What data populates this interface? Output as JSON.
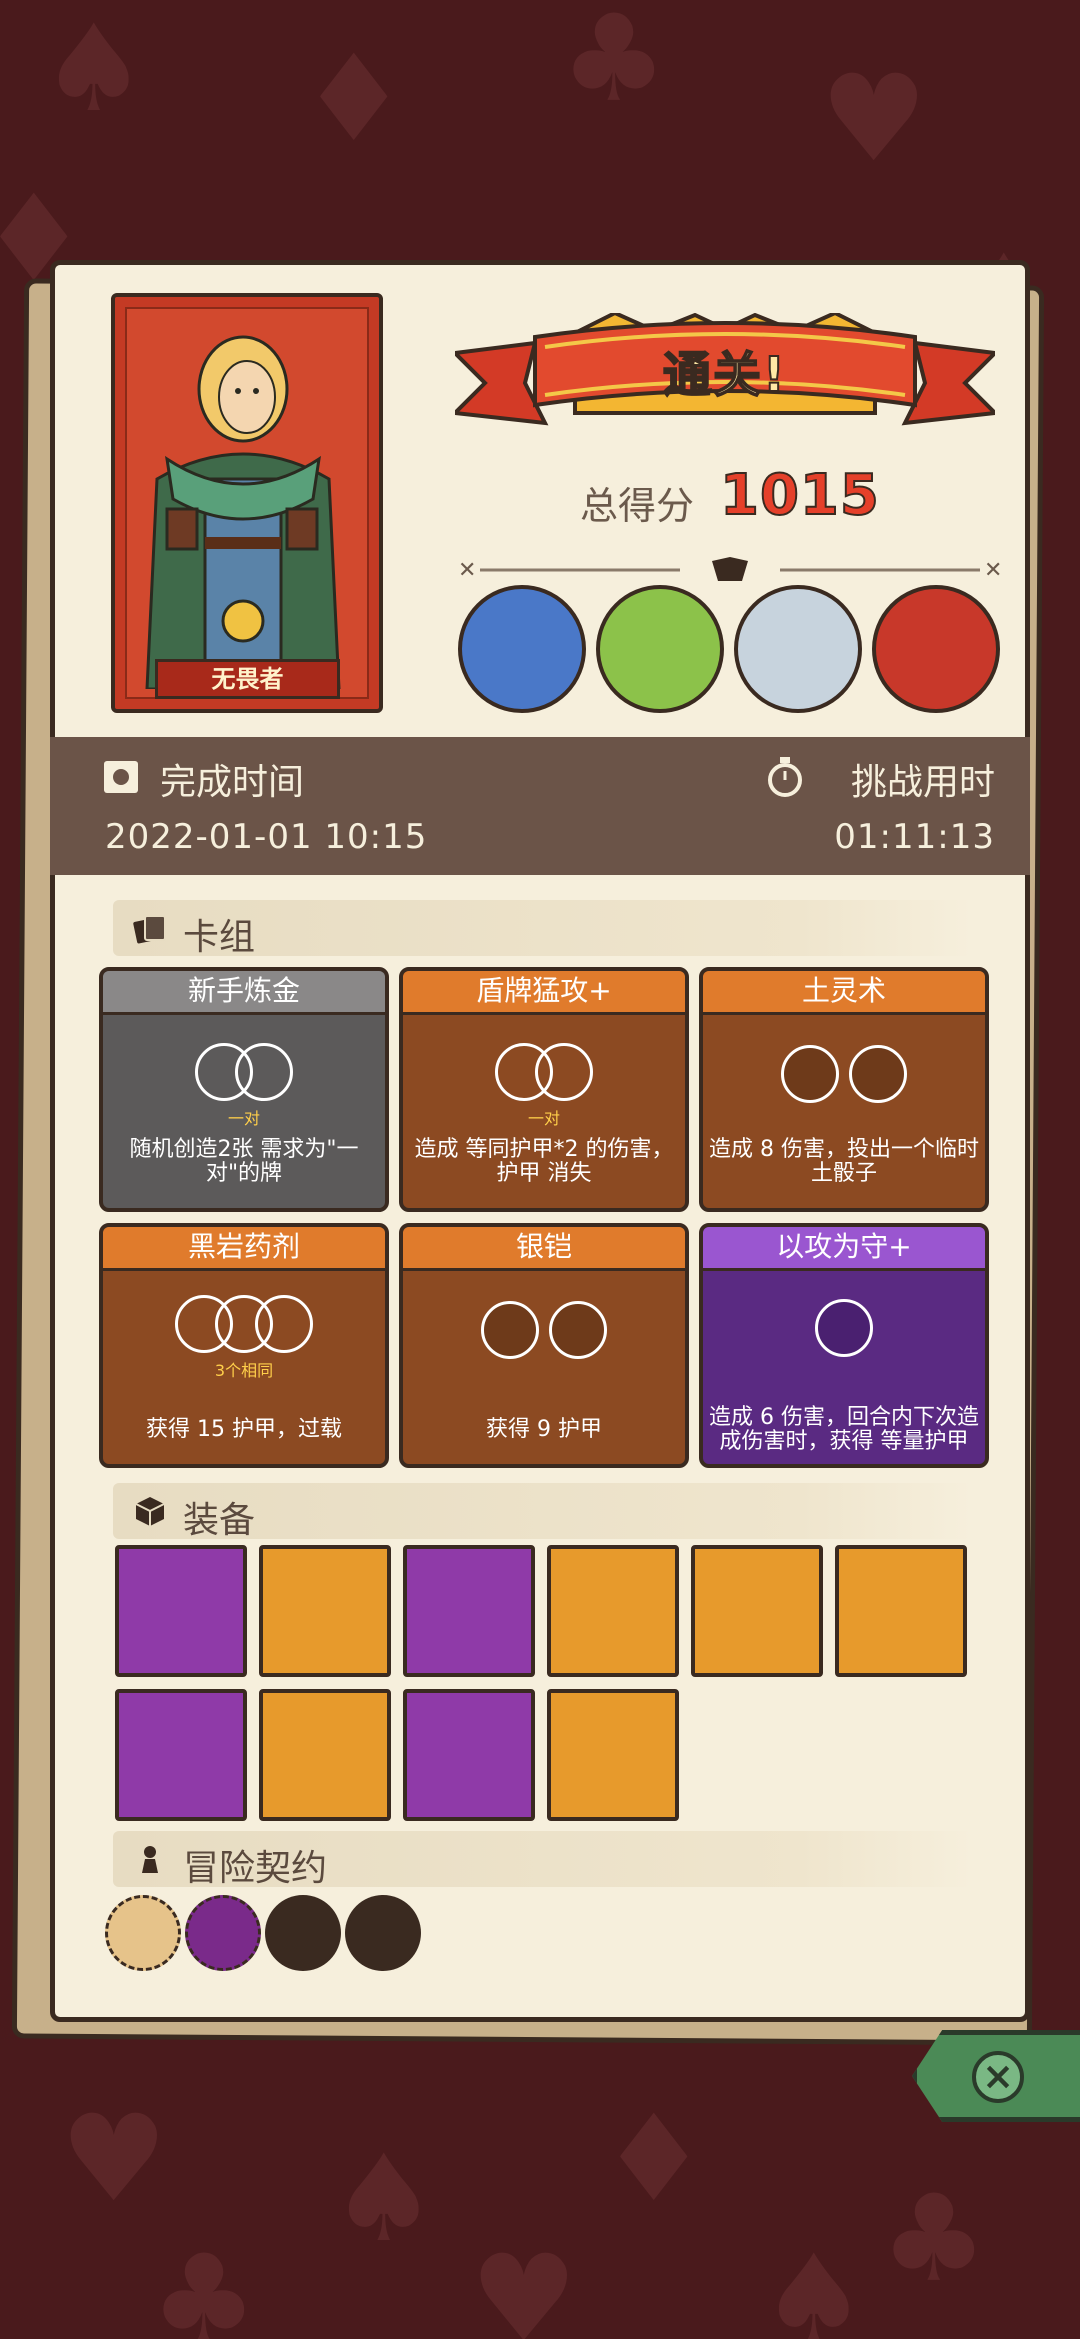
{
  "hero": {
    "name": "无畏者"
  },
  "result": {
    "title": "通关!",
    "score_label": "总得分",
    "score": "1015"
  },
  "bosses": [
    {
      "name": "mushroom-sage-portrait",
      "color": "#4a78c8"
    },
    {
      "name": "green-dragon-portrait",
      "color": "#8cc24a"
    },
    {
      "name": "masked-yeti-portrait",
      "color": "#c7d3dd"
    },
    {
      "name": "red-demon-portrait",
      "color": "#c8382a"
    }
  ],
  "times": {
    "finish_label": "完成时间",
    "finish_value": "2022-01-01  10:15",
    "challenge_label": "挑战用时",
    "challenge_value": "01:11:13"
  },
  "deck": {
    "title": "卡组",
    "cards": [
      {
        "name": "新手炼金",
        "style": "grey",
        "sub": "一对",
        "desc": "随机创造2张 需求为\"一对\"的牌"
      },
      {
        "name": "盾牌猛攻+",
        "style": "orange",
        "sub": "一对",
        "desc": "造成 等同护甲*2 的伤害，护甲 消失"
      },
      {
        "name": "土灵术",
        "style": "orange",
        "sub": "",
        "desc": "造成 8 伤害，投出一个临时土骰子"
      },
      {
        "name": "黑岩药剂",
        "style": "orange",
        "sub": "3个相同",
        "desc": "获得 15 护甲，过载"
      },
      {
        "name": "银铠",
        "style": "orange",
        "sub": "",
        "desc": "获得 9 护甲"
      },
      {
        "name": "以攻为守+",
        "style": "purple",
        "sub": "",
        "desc": "造成 6 伤害，回合内下次造成伤害时，获得 等量护甲"
      }
    ]
  },
  "equipment": {
    "title": "装备",
    "items": [
      {
        "icon": "golden-heart-shield-icon",
        "rarity": "purple"
      },
      {
        "icon": "gold-coin-icon",
        "rarity": "orange"
      },
      {
        "icon": "emerald-bracer-icon",
        "rarity": "purple"
      },
      {
        "icon": "roast-meat-icon",
        "rarity": "orange"
      },
      {
        "icon": "blue-gem-stones-icon",
        "rarity": "orange"
      },
      {
        "icon": "round-target-shield-icon",
        "rarity": "orange"
      },
      {
        "icon": "golden-cube-icon",
        "rarity": "purple"
      },
      {
        "icon": "hexagram-amulet-icon",
        "rarity": "orange"
      },
      {
        "icon": "wooden-round-shield-icon",
        "rarity": "purple"
      },
      {
        "icon": "blue-pumpkin-shield-icon",
        "rarity": "orange"
      }
    ]
  },
  "contracts": {
    "title": "冒险契约",
    "items": [
      "scroll-icon",
      "purple-splat-icon",
      "pipe-icon",
      "green-bird-icon"
    ]
  }
}
